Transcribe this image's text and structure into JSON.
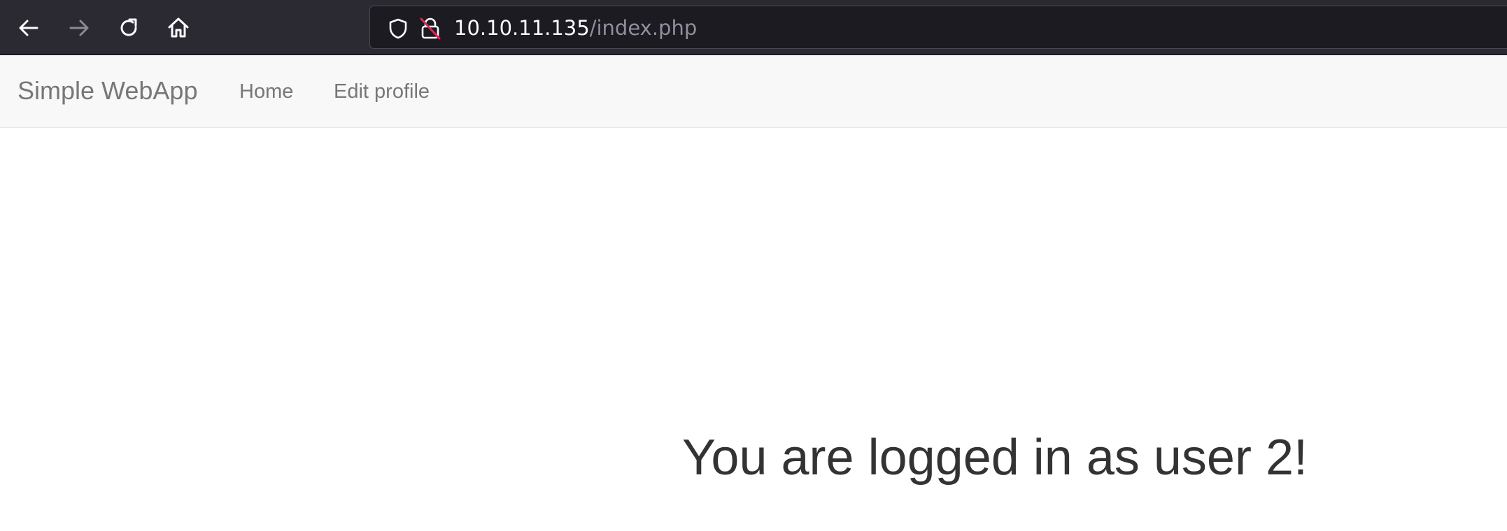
{
  "browser": {
    "url_host": "10.10.11.135",
    "url_path": "/index.php",
    "icons": [
      "back-arrow-icon",
      "forward-arrow-icon",
      "reload-icon",
      "home-icon",
      "shield-icon",
      "insecure-lock-icon"
    ]
  },
  "navbar": {
    "brand": "Simple WebApp",
    "links": [
      {
        "label": "Home"
      },
      {
        "label": "Edit profile"
      }
    ]
  },
  "main": {
    "heading": "You are logged in as user 2!"
  },
  "colors": {
    "toolbar_bg": "#2b2a33",
    "urlbar_bg": "#1c1b22",
    "navbar_bg": "#f8f8f8",
    "nav_text": "#777777",
    "heading_text": "#333333",
    "insecure_slash": "#e22850"
  }
}
